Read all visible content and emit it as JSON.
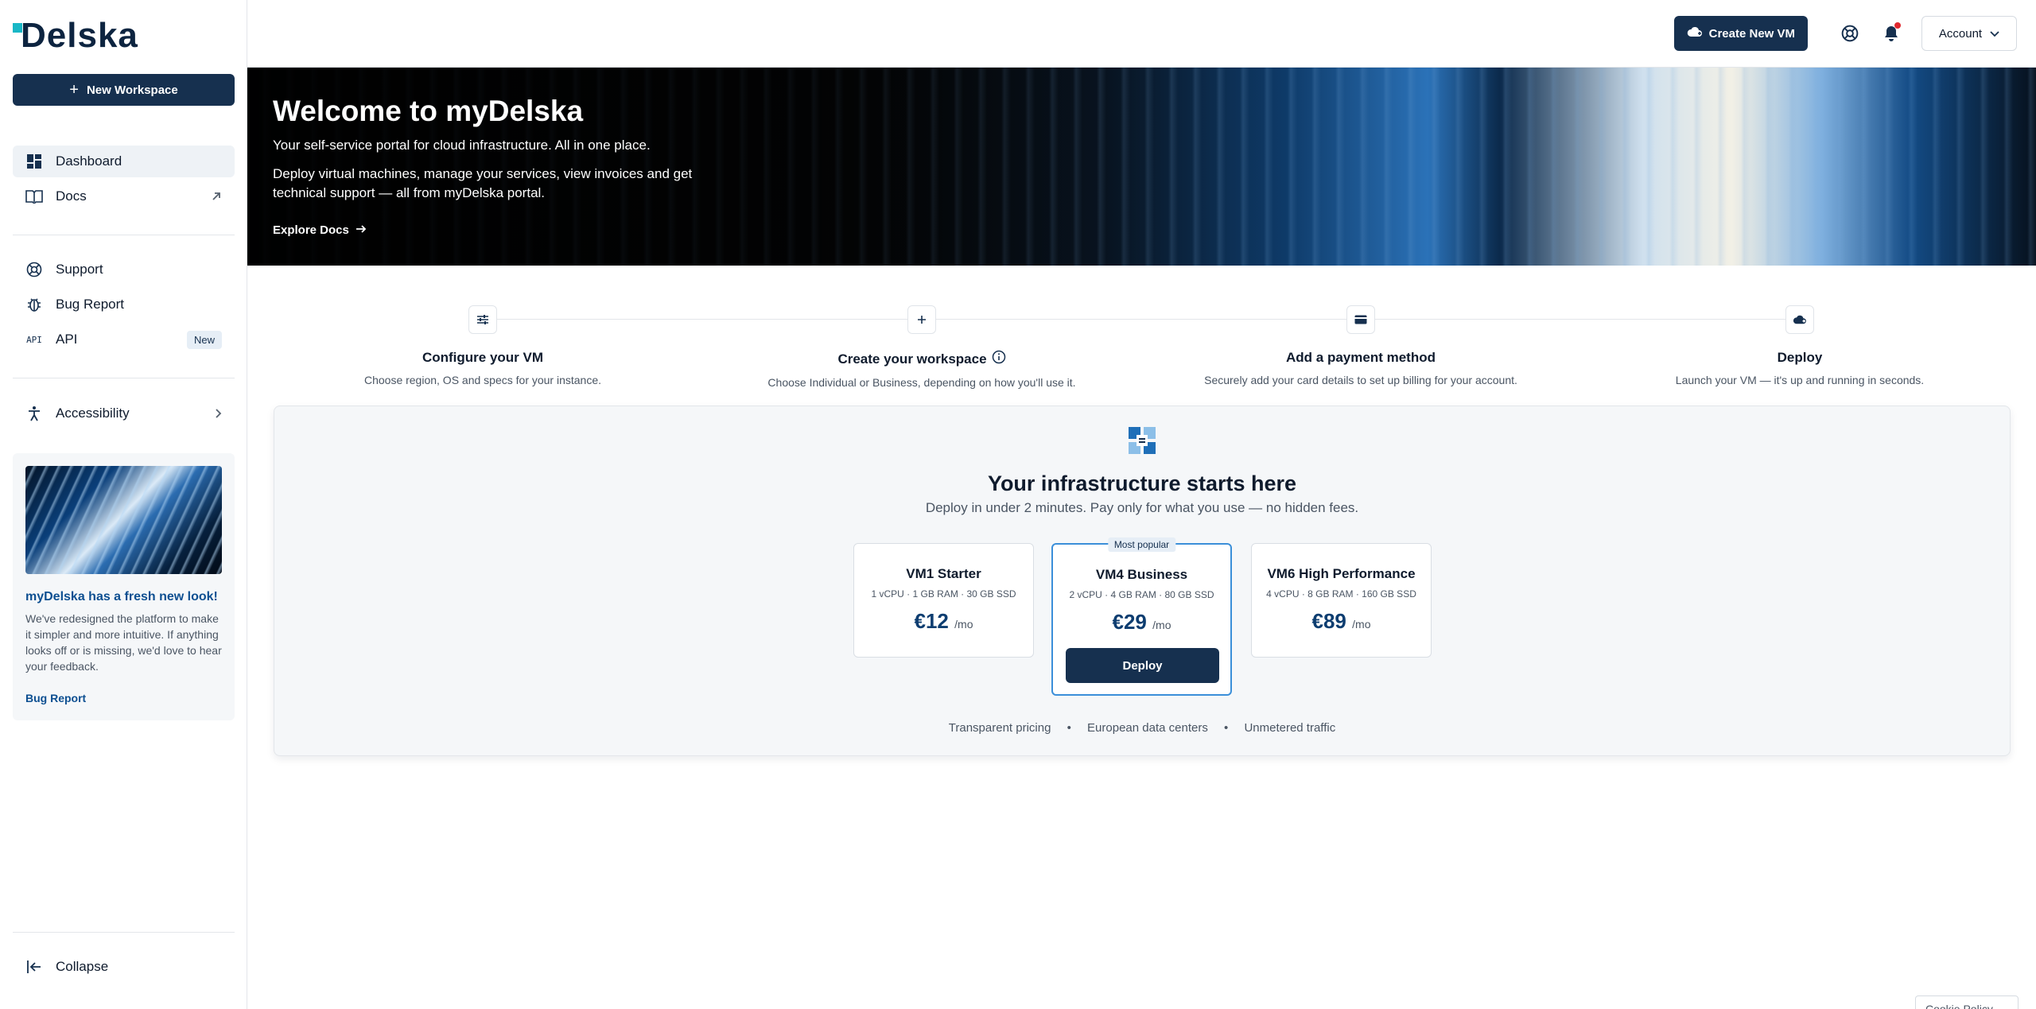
{
  "brand": {
    "logo_text": "Delska"
  },
  "sidebar": {
    "new_workspace": "New Workspace",
    "items": [
      {
        "label": "Dashboard"
      },
      {
        "label": "Docs"
      },
      {
        "label": "Support"
      },
      {
        "label": "Bug Report"
      },
      {
        "label": "API",
        "badge": "New",
        "icon_text": "API"
      },
      {
        "label": "Accessibility"
      }
    ],
    "promo": {
      "title": "myDelska has a fresh new look!",
      "text": "We've redesigned the platform to make it simpler and more intuitive. If anything looks off or is missing, we'd love to hear your feedback.",
      "link": "Bug Report"
    },
    "collapse": "Collapse"
  },
  "header": {
    "create_vm": "Create New VM",
    "account": "Account"
  },
  "hero": {
    "title": "Welcome to myDelska",
    "subtitle": "Your self-service portal for cloud infrastructure. All in one place.",
    "description": "Deploy virtual machines, manage your services, view invoices and get technical support — all from myDelska portal.",
    "cta": "Explore Docs"
  },
  "steps": [
    {
      "title": "Configure your VM",
      "desc": "Choose region, OS and specs for your instance."
    },
    {
      "title": "Create your workspace",
      "desc": "Choose Individual or Business, depending on how you'll use it."
    },
    {
      "title": "Add a payment method",
      "desc": "Securely add your card details to set up billing for your account."
    },
    {
      "title": "Deploy",
      "desc": "Launch your VM — it's up and running in seconds."
    }
  ],
  "infra": {
    "title": "Your infrastructure starts here",
    "subtitle": "Deploy in under 2 minutes. Pay only for what you use — no hidden fees.",
    "plans": [
      {
        "name": "VM1 Starter",
        "specs": "1 vCPU · 1 GB RAM · 30 GB SSD",
        "price": "€12",
        "period": "/mo"
      },
      {
        "name": "VM4 Business",
        "specs": "2 vCPU · 4 GB RAM · 80 GB SSD",
        "price": "€29",
        "period": "/mo",
        "badge": "Most popular",
        "cta": "Deploy"
      },
      {
        "name": "VM6 High Performance",
        "specs": "4 vCPU · 8 GB RAM · 160 GB SSD",
        "price": "€89",
        "period": "/mo"
      }
    ],
    "features": [
      "Transparent pricing",
      "European data centers",
      "Unmetered traffic"
    ],
    "separator": "•"
  },
  "cookie": "Cookie Policy",
  "colors": {
    "primary": "#16304f",
    "accent": "#19b7c6",
    "link": "#0d4f91",
    "notification": "#e0282e"
  }
}
